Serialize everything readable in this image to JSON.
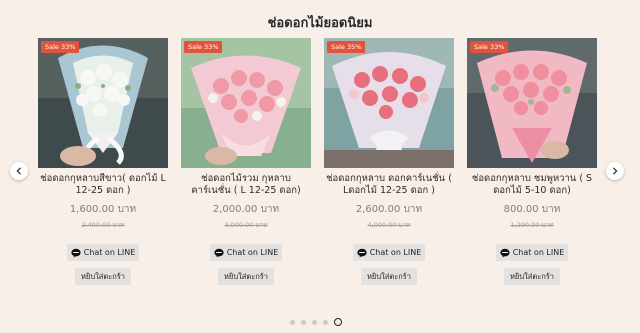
{
  "section_title": "ช่อดอกไม้ยอดนิยม",
  "line_button_label": "Chat on LINE",
  "cart_button_label": "หยิบใส่ตะกร้า",
  "products": [
    {
      "badge": "Sale 33%",
      "name": "ช่อดอกกุหลาบสีขาว( ดอกไม้ L 12-25 ดอก )",
      "price": "1,600.00 บาท",
      "old_price": "2,400.00 บาท"
    },
    {
      "badge": "Sale 33%",
      "name": "ช่อดอกไม้รวม กุหลาบ คาร์เนชั่น ( L 12-25 ดอก)",
      "price": "2,000.00 บาท",
      "old_price": "3,000.00 บาท"
    },
    {
      "badge": "Sale 35%",
      "name": "ช่อดอกกุหลาบ ดอกคาร์เนชั่น ( Lดอกไม้ 12-25 ดอก )",
      "price": "2,600.00 บาท",
      "old_price": "4,000.00 บาท"
    },
    {
      "badge": "Sale 33%",
      "name": "ช่อดอกกุหลาบ ชมพูหวาน ( S ดอกไม้ 5-10 ดอก)",
      "price": "800.00 บาท",
      "old_price": "1,200.00 บาท"
    }
  ],
  "pagination": {
    "total": 5,
    "active": 5
  },
  "colors": {
    "background": "#f8efe8",
    "badge": "#e2533a",
    "button": "#e3e2e0"
  }
}
